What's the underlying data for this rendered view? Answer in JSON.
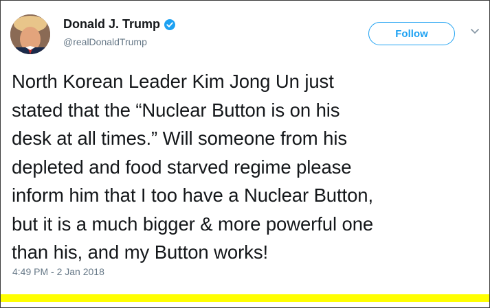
{
  "author": {
    "name": "Donald J. Trump",
    "handle": "@realDonaldTrump",
    "verified": true
  },
  "actions": {
    "follow_label": "Follow"
  },
  "icons": {
    "verified": "verified-badge-icon",
    "menu": "chevron-down-icon"
  },
  "tweet": {
    "lines": [
      "North Korean Leader Kim Jong Un just",
      "stated that the “Nuclear Button is on his",
      "desk at all times.” Will someone from his",
      "depleted and food starved regime please",
      "inform him that I too have a Nuclear Button,",
      "but it is a much bigger & more powerful one",
      "than his, and my Button works!"
    ],
    "timestamp": "4:49 PM - 2 Jan 2018"
  },
  "colors": {
    "accent": "#1da1f2",
    "text": "#14171a",
    "muted": "#657786",
    "bottom_bar": "#ffff00"
  }
}
